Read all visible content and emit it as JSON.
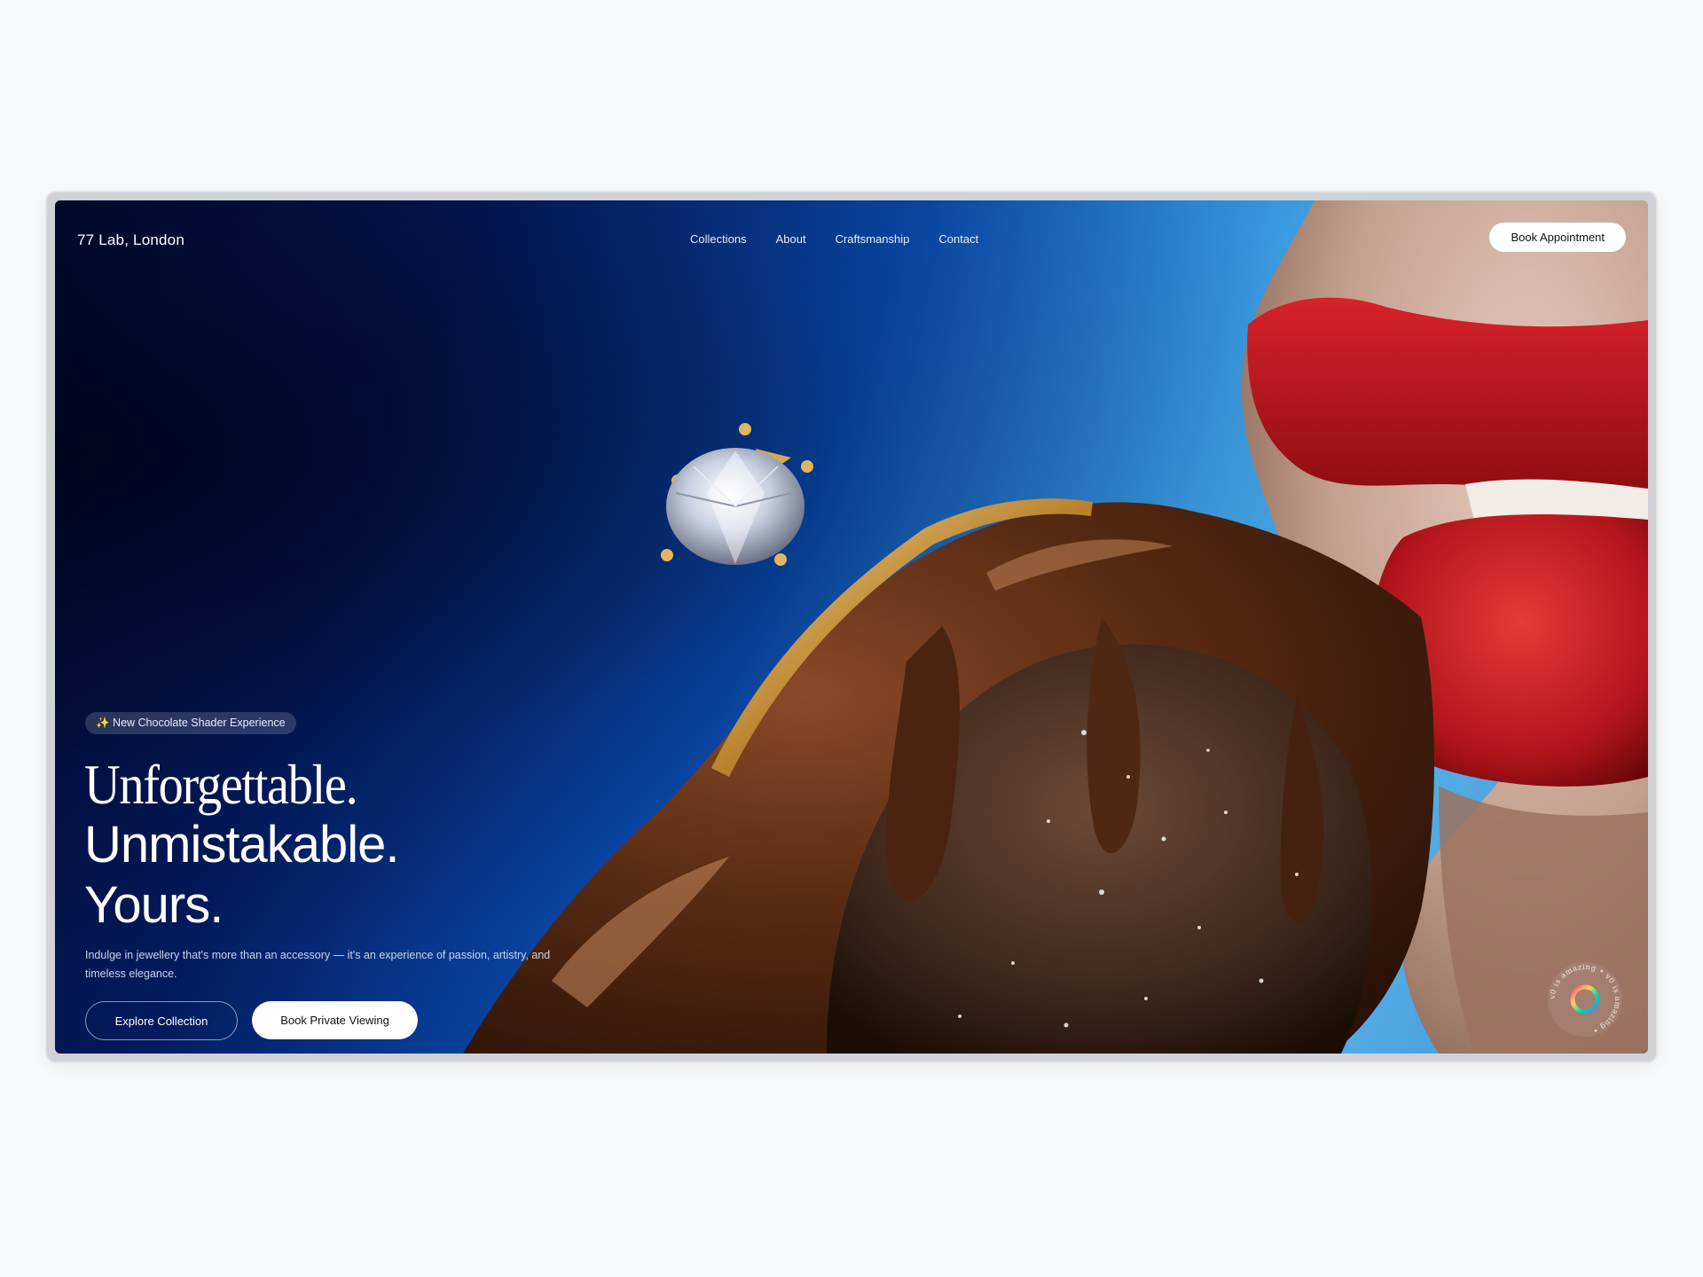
{
  "header": {
    "brand": "77 Lab, London",
    "nav": [
      {
        "label": "Collections"
      },
      {
        "label": "About"
      },
      {
        "label": "Craftsmanship"
      },
      {
        "label": "Contact"
      }
    ],
    "cta": "Book Appointment"
  },
  "hero": {
    "badge_icon": "sparkle-icon",
    "badge": "✨ New Chocolate Shader Experience",
    "headline": [
      "Unforgettable.",
      "Unmistakable.",
      "Yours."
    ],
    "description": "Indulge in jewellery that's more than an accessory — it's an experience of passion, artistry, and timeless elegance.",
    "primary_button": "Explore Collection",
    "secondary_button": "Book Private Viewing"
  },
  "seal": {
    "icon": "rotating-badge-icon",
    "text": "v0 is amazing • v0 is amazing •"
  },
  "colors": {
    "page_bg": "#f7f8fa",
    "deep_navy": "#020a2e",
    "sky_blue": "#5bb5ec",
    "lip_red": "#c8161e",
    "chocolate": "#5a2e16",
    "gold": "#c8963e"
  }
}
